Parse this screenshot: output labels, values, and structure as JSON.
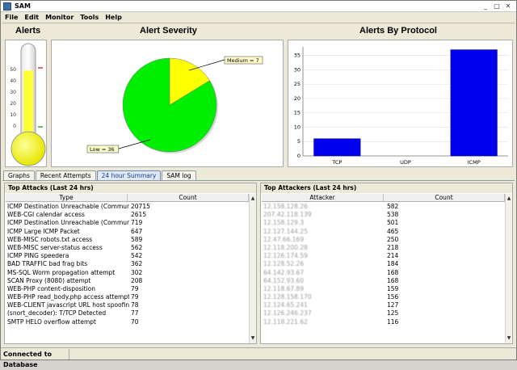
{
  "window": {
    "title": "SAM",
    "buttons": [
      "_",
      "□",
      "✕"
    ]
  },
  "menu": [
    "File",
    "Edit",
    "Monitor",
    "Tools",
    "Help"
  ],
  "alerts": {
    "title": "Alerts",
    "ticks": [
      "50",
      "40",
      "30",
      "20",
      "10",
      "0"
    ],
    "level_fraction": 0.78
  },
  "severity": {
    "title": "Alert Severity"
  },
  "protocol": {
    "title": "Alerts By Protocol"
  },
  "chart_data": [
    {
      "type": "pie",
      "title": "Alert Severity",
      "labels": [
        "Low = 36",
        "Medium = 7"
      ],
      "values": [
        36,
        7
      ],
      "colors": [
        "#00ee00",
        "#ffff00"
      ]
    },
    {
      "type": "bar",
      "title": "Alerts By Protocol",
      "categories": [
        "TCP",
        "UDP",
        "ICMP"
      ],
      "values": [
        6,
        0,
        37
      ],
      "ylim": [
        0,
        38
      ],
      "yticks": [
        "0",
        "5",
        "10",
        "15",
        "20",
        "25",
        "30",
        "35"
      ],
      "color": "#0000ee"
    }
  ],
  "tabs": [
    "Graphs",
    "Recent Attempts",
    "24 hour Summary",
    "SAM log"
  ],
  "top_attacks": {
    "title": "Top Attacks  (Last 24 hrs)",
    "columns": [
      "Type",
      "Count"
    ],
    "rows": [
      [
        "ICMP Destination Unreachable (Commun...",
        "20715"
      ],
      [
        "WEB-CGI calendar access",
        "2615"
      ],
      [
        "ICMP Destination Unreachable (Commun...",
        "719"
      ],
      [
        "ICMP Large ICMP Packet",
        "647"
      ],
      [
        "WEB-MISC robots.txt access",
        "589"
      ],
      [
        "WEB-MISC server-status access",
        "562"
      ],
      [
        "ICMP PING speedera",
        "542"
      ],
      [
        "BAD TRAFFIC bad frag bits",
        "362"
      ],
      [
        "MS-SQL Worm propagation attempt",
        "302"
      ],
      [
        "SCAN Proxy (8080) attempt",
        "208"
      ],
      [
        "WEB-PHP content-disposition",
        "79"
      ],
      [
        "WEB-PHP read_body.php access attempt",
        "79"
      ],
      [
        "WEB-CLIENT javascript URL host spoofin...",
        "78"
      ],
      [
        "(snort_decoder): T/TCP Detected",
        "77"
      ],
      [
        "SMTP HELO overflow attempt",
        "70"
      ]
    ]
  },
  "top_attackers": {
    "title": "Top Attackers  (Last 24 hrs)",
    "columns": [
      "Attacker",
      "Count"
    ],
    "rows": [
      [
        "12.158.128.26",
        "582"
      ],
      [
        "207.42.118.139",
        "538"
      ],
      [
        "12.158.129.3",
        "501"
      ],
      [
        "12.127.144.25",
        "465"
      ],
      [
        "12.47.66.169",
        "250"
      ],
      [
        "12.118.200.28",
        "218"
      ],
      [
        "12.126.174.59",
        "214"
      ],
      [
        "12.128.52.26",
        "184"
      ],
      [
        "64.142.93.67",
        "168"
      ],
      [
        "64.152.93.60",
        "168"
      ],
      [
        "12.118.67.89",
        "159"
      ],
      [
        "12.128.158.170",
        "156"
      ],
      [
        "12.124.65.241",
        "127"
      ],
      [
        "12.126.246.237",
        "125"
      ],
      [
        "12.118.221.62",
        "116"
      ]
    ]
  },
  "status": {
    "text": "Connected to Database"
  }
}
